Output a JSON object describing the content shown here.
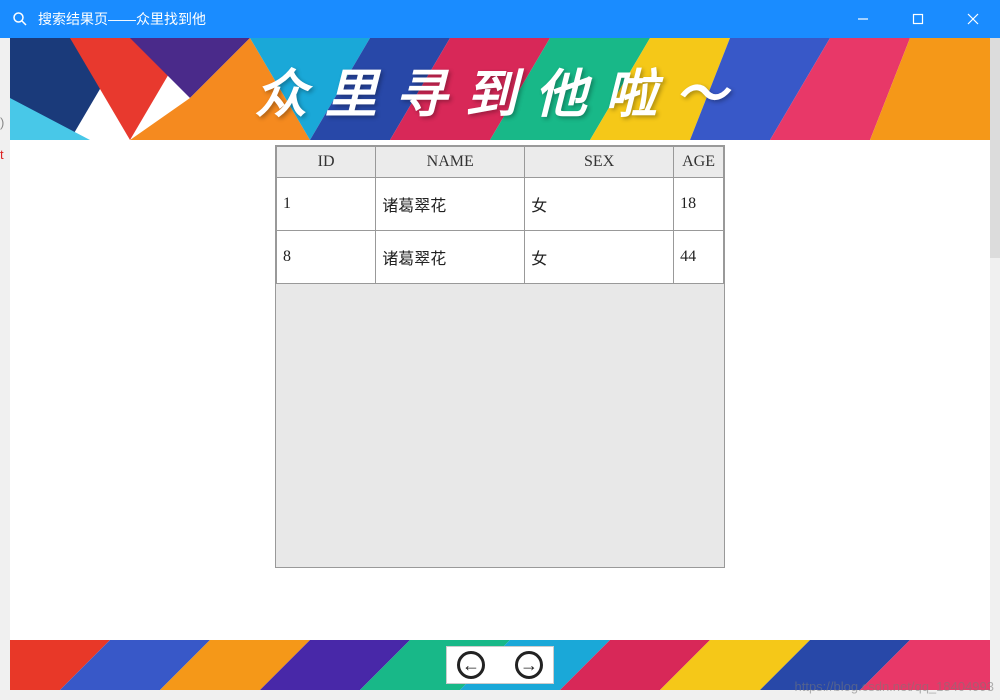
{
  "window": {
    "title": "搜索结果页——众里找到他"
  },
  "banner": {
    "heading": "众里寻到他啦～"
  },
  "table": {
    "headers": {
      "id": "ID",
      "name": "NAME",
      "sex": "SEX",
      "age": "AGE"
    },
    "rows": [
      {
        "id": "1",
        "name": "诸葛翠花",
        "sex": "女",
        "age": "18"
      },
      {
        "id": "8",
        "name": "诸葛翠花",
        "sex": "女",
        "age": "44"
      }
    ]
  },
  "nav": {
    "prev_glyph": "←",
    "next_glyph": "→"
  },
  "side_fragments": {
    "a": ")",
    "b": "t"
  },
  "watermark": "https://blog.csdn.net/qq_18404993"
}
